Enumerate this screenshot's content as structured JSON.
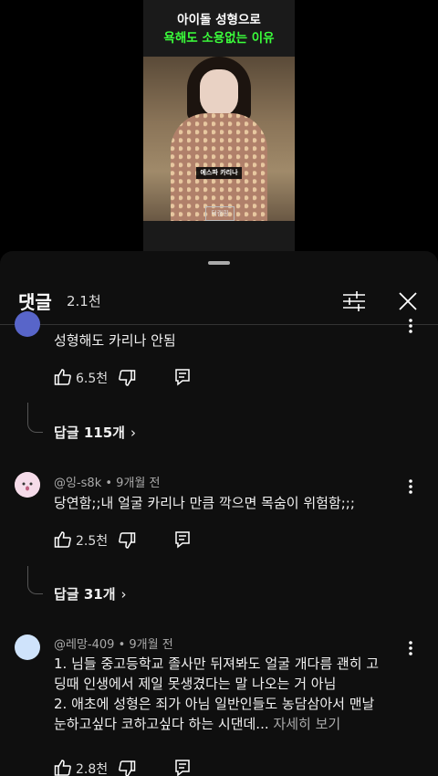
{
  "video": {
    "title_line1": "아이돌 성형으로",
    "title_line2": "욕해도 소용없는 이유",
    "name_tag": "에스파 카리나",
    "channel_logo": "덕캠핑"
  },
  "comments_panel": {
    "title": "댓글",
    "count": "2.1천",
    "icons": {
      "filter": "filter-sliders-icon",
      "close": "close-icon"
    }
  },
  "comments": [
    {
      "text": "성형해도 카리나 안됨",
      "likes": "6.5천",
      "replies_label": "답글 115개"
    },
    {
      "author": "@잉-s8k",
      "time": "9개월 전",
      "text": "당연함;;내 얼굴 카리나 만큼 깍으면 목숨이 위험함;;;",
      "likes": "2.5천",
      "replies_label": "답글 31개"
    },
    {
      "author": "@레망-409",
      "time": "9개월 전",
      "text_lines": [
        "1. 님들 중고등학교 졸사만 뒤져봐도 얼굴 개다름 괜히 고",
        "딩때 인생에서 제일 못생겼다는 말 나오는 거 아님",
        "2. 애초에 성형은 죄가 아님 일반인들도 농담삼아서 맨날",
        "눈하고싶다 코하고싶다 하는 시댄데..."
      ],
      "more": "자세히 보기",
      "likes": "2.8천"
    }
  ],
  "colors": {
    "accent_green": "#3bff3b",
    "panel_bg": "#0f0f0f"
  }
}
